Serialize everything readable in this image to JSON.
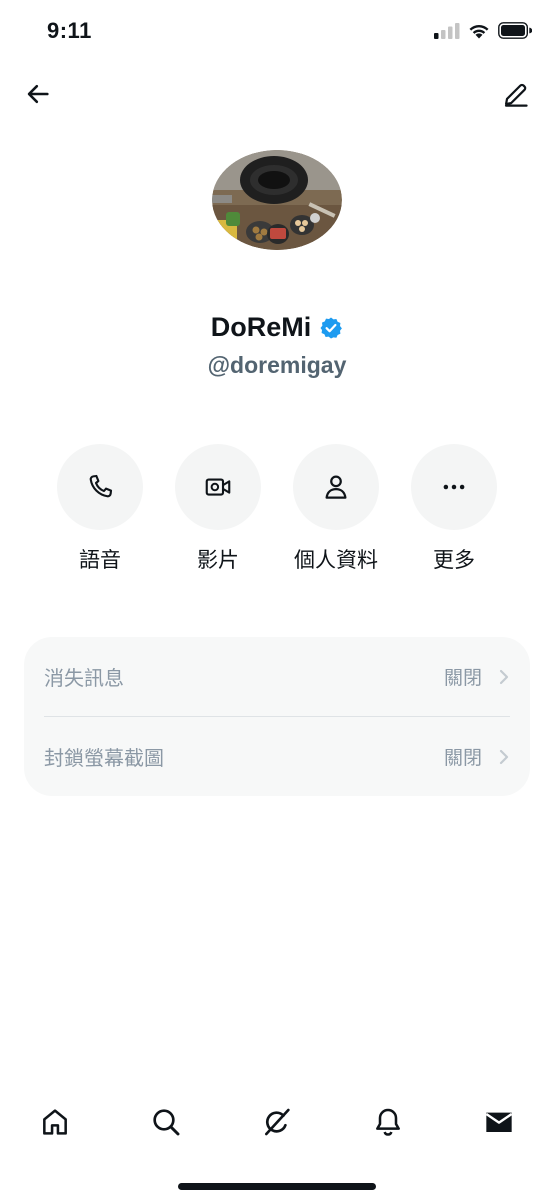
{
  "status_bar": {
    "time": "9:11"
  },
  "profile": {
    "name": "DoReMi",
    "handle": "@doremigay",
    "verified": true
  },
  "actions": [
    {
      "label": "語音",
      "icon": "phone-icon"
    },
    {
      "label": "影片",
      "icon": "video-icon"
    },
    {
      "label": "個人資料",
      "icon": "person-icon"
    },
    {
      "label": "更多",
      "icon": "more-icon"
    }
  ],
  "settings": [
    {
      "label": "消失訊息",
      "value": "關閉"
    },
    {
      "label": "封鎖螢幕截圖",
      "value": "關閉"
    }
  ],
  "tabbar": [
    "home-icon",
    "search-icon",
    "grok-icon",
    "notifications-icon",
    "messages-icon"
  ],
  "colors": {
    "verified": "#1d9bf0",
    "text": "#0f1419",
    "secondary": "#536471",
    "muted": "#8b98a5"
  }
}
